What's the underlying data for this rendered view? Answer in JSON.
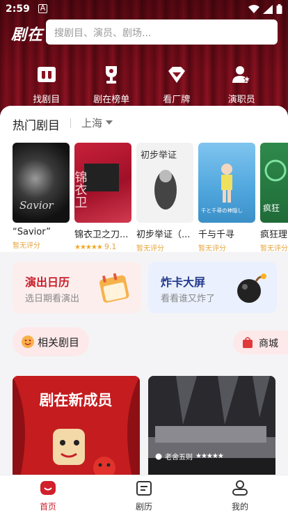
{
  "status_bar": {
    "time": "2:59",
    "app_indicator": "A"
  },
  "header": {
    "logo": "剧在",
    "search_placeholder": "搜剧目、演员、剧场..."
  },
  "quick_nav": [
    {
      "label": "找剧目",
      "icon": "masks-icon"
    },
    {
      "label": "剧在榜单",
      "icon": "trophy-icon"
    },
    {
      "label": "看厂牌",
      "icon": "gem-icon"
    },
    {
      "label": "演职员",
      "icon": "person-star-icon"
    }
  ],
  "hot_shows": {
    "title": "热门剧目",
    "city": "上海",
    "items": [
      {
        "name": "“Savior”",
        "rating_text": "暂无评分",
        "poster_text": "Savior"
      },
      {
        "name": "锦衣卫之刀...",
        "rating_text": "",
        "score": "9.1",
        "stars": "★★★★★",
        "poster_text": "锦衣卫"
      },
      {
        "name": "初步举证（...",
        "rating_text": "暂无评分",
        "poster_text": "初步举证"
      },
      {
        "name": "千与千寻",
        "rating_text": "暂无评分",
        "poster_text": "千と千尋の神隠し"
      },
      {
        "name": "疯狂理...",
        "rating_text": "暂无评分",
        "poster_text": "疯狂"
      }
    ]
  },
  "promos": [
    {
      "title": "演出日历",
      "subtitle": "选日期看演出",
      "icon": "calendar-icon"
    },
    {
      "title": "炸卡大屏",
      "subtitle": "看看谁又炸了",
      "icon": "bomb-icon"
    }
  ],
  "related": {
    "label": "相关剧目",
    "mall_label": "商城"
  },
  "feed": [
    {
      "banner_text": "剧在新成员"
    },
    {
      "author": "老舍五则",
      "stars": "★★★★★"
    }
  ],
  "tabbar": [
    {
      "label": "首页",
      "active": true
    },
    {
      "label": "剧历",
      "active": false
    },
    {
      "label": "我的",
      "active": false
    }
  ],
  "colors": {
    "brand_red": "#d0202c",
    "hero_dark": "#6b0c18"
  }
}
